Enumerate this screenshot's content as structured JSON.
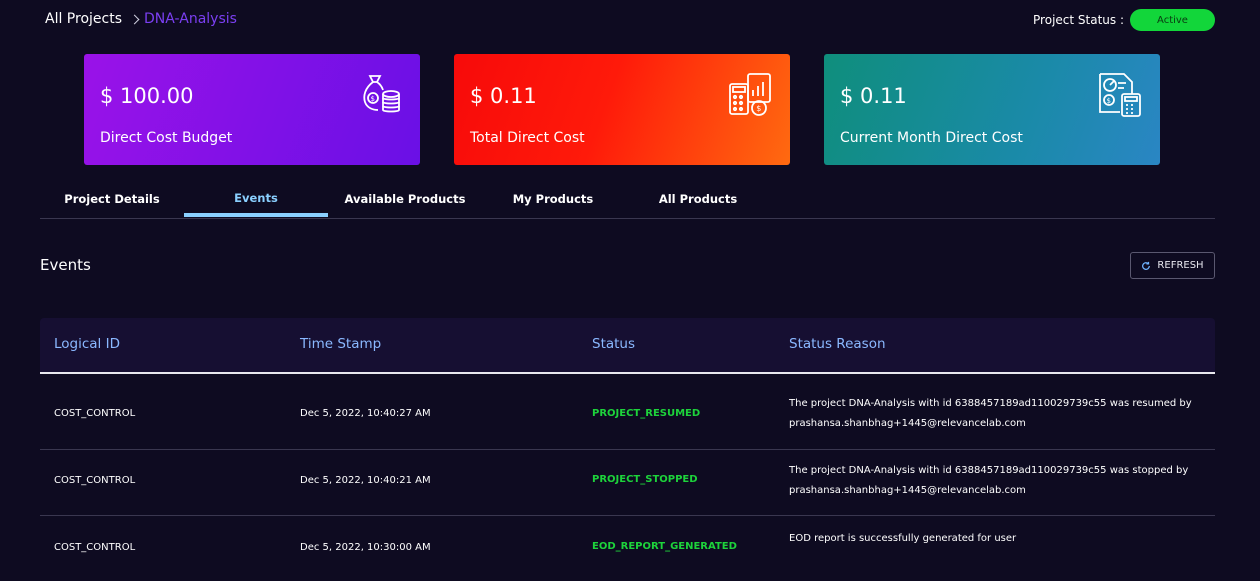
{
  "breadcrumb": {
    "root": "All Projects",
    "current": "DNA-Analysis"
  },
  "project_status": {
    "label": "Project Status :",
    "value": "Active"
  },
  "cards": [
    {
      "amount": "$ 100.00",
      "label": "Direct Cost Budget",
      "icon": "money-bag-icon"
    },
    {
      "amount": "$ 0.11",
      "label": "Total Direct Cost",
      "icon": "calculator-chart-icon"
    },
    {
      "amount": "$ 0.11",
      "label": "Current Month Direct Cost",
      "icon": "report-calculator-icon"
    }
  ],
  "tabs": [
    "Project Details",
    "Events",
    "Available Products",
    "My Products",
    "All Products"
  ],
  "active_tab": "Events",
  "section": {
    "title": "Events",
    "refresh_label": "REFRESH"
  },
  "table": {
    "headers": [
      "Logical ID",
      "Time Stamp",
      "Status",
      "Status Reason"
    ],
    "rows": [
      {
        "logical_id": "COST_CONTROL",
        "timestamp": "Dec 5, 2022, 10:40:27 AM",
        "status": "PROJECT_RESUMED",
        "reason_line1": "The project DNA-Analysis with id 6388457189ad110029739c55 was resumed by",
        "reason_line2": "prashansa.shanbhag+1445@relevancelab.com"
      },
      {
        "logical_id": "COST_CONTROL",
        "timestamp": "Dec 5, 2022, 10:40:21 AM",
        "status": "PROJECT_STOPPED",
        "reason_line1": "The project DNA-Analysis with id 6388457189ad110029739c55 was stopped by",
        "reason_line2": "prashansa.shanbhag+1445@relevancelab.com"
      },
      {
        "logical_id": "COST_CONTROL",
        "timestamp": "Dec 5, 2022, 10:30:00 AM",
        "status": "EOD_REPORT_GENERATED",
        "reason_line1": "EOD report is successfully generated for user",
        "reason_line2": ""
      }
    ]
  },
  "colors": {
    "background": "#0e0b21",
    "active_status": "#12d63a",
    "tab_active": "#8ad0ff",
    "header_text": "#8ab8ff"
  }
}
